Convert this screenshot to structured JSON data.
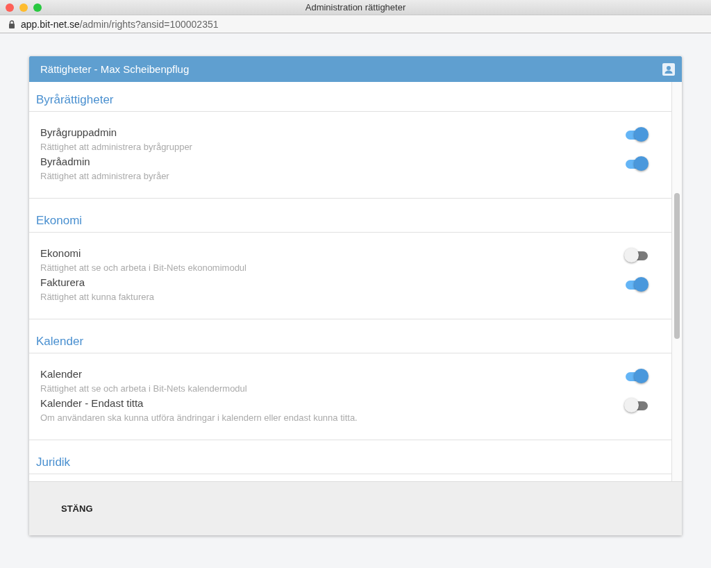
{
  "window": {
    "title": "Administration rättigheter"
  },
  "address_bar": {
    "domain": "app.bit-net.se",
    "path": "/admin/rights?ansid=100002351"
  },
  "dialog": {
    "title": "Rättigheter - Max Scheibenpflug",
    "sections": [
      {
        "heading": "Byrårättigheter",
        "items": [
          {
            "name": "Byrågruppadmin",
            "description": "Rättighet att administrera byrågrupper",
            "on": true
          },
          {
            "name": "Byråadmin",
            "description": "Rättighet att administrera byråer",
            "on": true
          }
        ]
      },
      {
        "heading": "Ekonomi",
        "items": [
          {
            "name": "Ekonomi",
            "description": "Rättighet att se och arbeta i Bit-Nets ekonomimodul",
            "on": false
          },
          {
            "name": "Fakturera",
            "description": "Rättighet att kunna fakturera",
            "on": true
          }
        ]
      },
      {
        "heading": "Kalender",
        "items": [
          {
            "name": "Kalender",
            "description": "Rättighet att se och arbeta i Bit-Nets kalendermodul",
            "on": true
          },
          {
            "name": "Kalender - Endast titta",
            "description": "Om användaren ska kunna utföra ändringar i kalendern eller endast kunna titta.",
            "on": false
          }
        ]
      },
      {
        "heading": "Juridik"
      }
    ],
    "close_button": "STÄNG"
  }
}
